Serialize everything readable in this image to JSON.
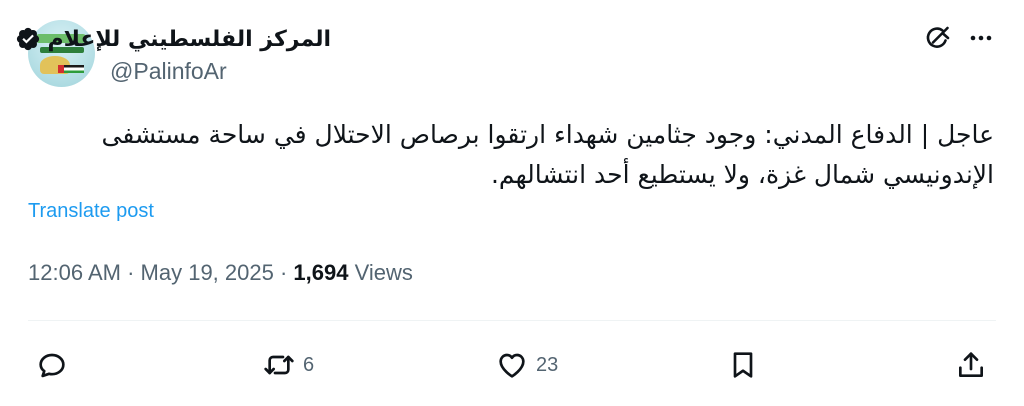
{
  "author": {
    "display_name": "المركز الفلسطيني للإعلام",
    "handle": "@PalinfoAr",
    "verified": true
  },
  "tweet": {
    "text": "عاجل | الدفاع المدني: وجود جثامين شهداء ارتقوا برصاص الاحتلال في ساحة مستشفى الإندونيسي شمال غزة، ولا يستطيع أحد انتشالهم.",
    "translate_label": "Translate post",
    "time": "12:06 AM",
    "date": "May 19, 2025",
    "views_count": "1,694",
    "views_label": "Views",
    "separator": "·"
  },
  "actions": {
    "reply_count": "",
    "retweet_count": "6",
    "like_count": "23"
  },
  "icons": {
    "top_right": [
      "grok-icon",
      "more-icon"
    ],
    "action_bar": [
      "reply-icon",
      "retweet-icon",
      "like-icon",
      "bookmark-icon",
      "share-icon"
    ]
  },
  "colors": {
    "text": "#0f1419",
    "secondary": "#536471",
    "link": "#1d9bf0",
    "divider": "#eff3f4"
  }
}
